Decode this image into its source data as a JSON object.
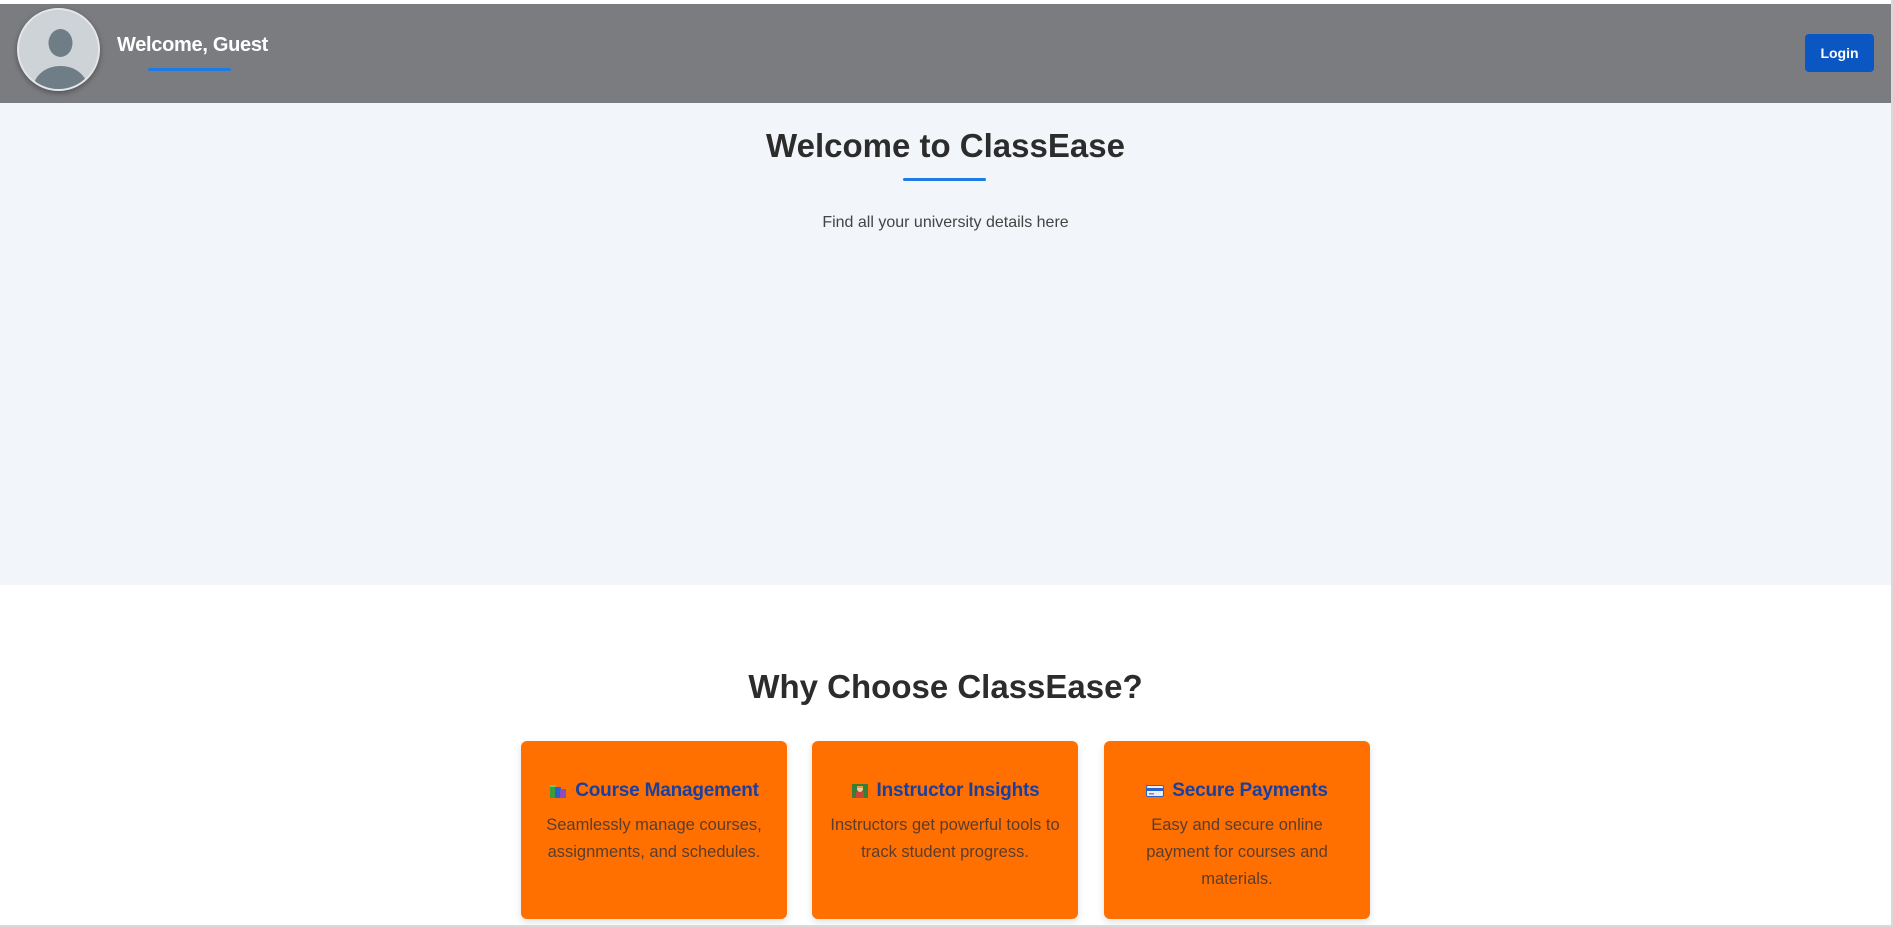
{
  "header": {
    "welcome_text": "Welcome, Guest",
    "login_label": "Login",
    "avatar_icon": "user-avatar-icon"
  },
  "hero": {
    "title": "Welcome to ClassEase",
    "subtitle": "Find all your university details here"
  },
  "features": {
    "title": "Why Choose ClassEase?",
    "cards": [
      {
        "icon": "books-icon",
        "title": "Course Management",
        "description": "Seamlessly manage courses, assignments, and schedules."
      },
      {
        "icon": "teacher-icon",
        "title": "Instructor Insights",
        "description": "Instructors get powerful tools to track student progress."
      },
      {
        "icon": "credit-card-icon",
        "title": "Secure Payments",
        "description": "Easy and secure online payment for courses and materials."
      }
    ]
  },
  "colors": {
    "header_bg": "#7b7c80",
    "accent_blue": "#1e7be6",
    "login_bg": "#0a56c3",
    "hero_bg": "#f2f6fa",
    "card_bg": "#ff7000",
    "card_title": "#1a3f9c"
  }
}
